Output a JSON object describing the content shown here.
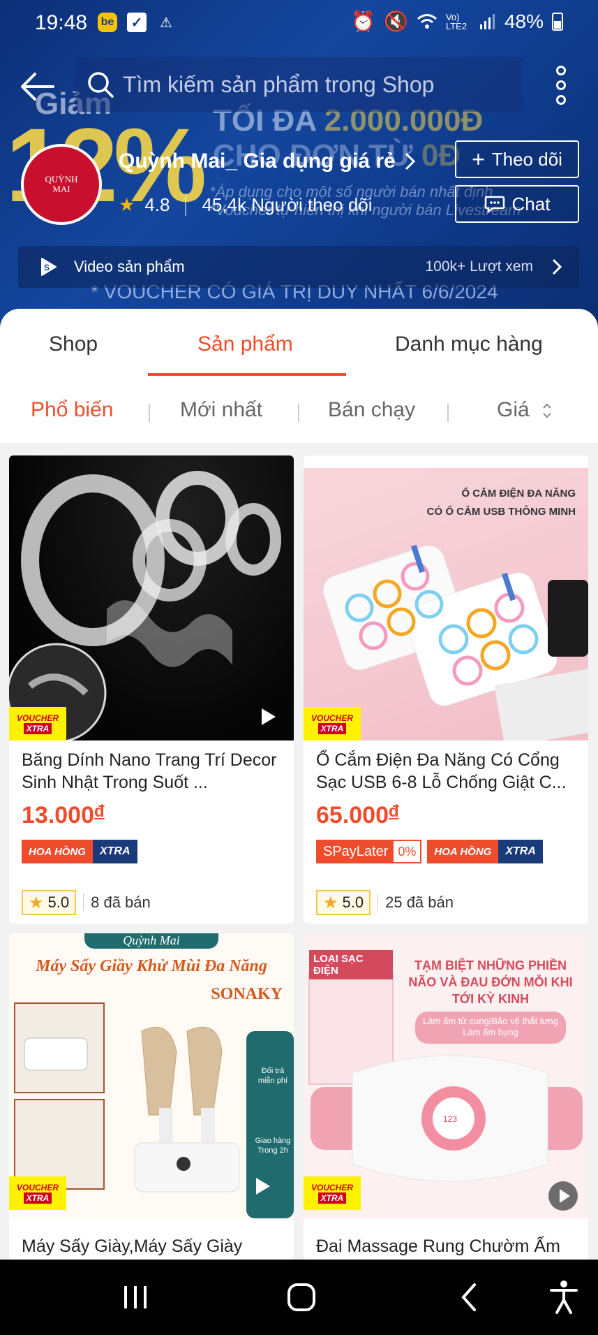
{
  "status_bar": {
    "time": "19:48",
    "battery": "48%",
    "network": "Vo) LTE2"
  },
  "search": {
    "placeholder": "Tìm kiếm sản phẩm trong Shop"
  },
  "banner": {
    "giam": "Giảm",
    "big_percent": "12%",
    "toi_da": "TỐI ĐA",
    "toi_da_amount": "2.000.000Đ",
    "cho_don": "CHO ĐƠN TỪ",
    "cho_don_amount": "0Đ",
    "note1": "*Áp dụng cho một số người bán nhất định",
    "note2": "*Voucher tự hiển thị khi người bán Livestream",
    "voucher_line": "* VOUCHER CÓ GIÁ TRỊ DUY NHẤT 6/6/2024"
  },
  "shop": {
    "avatar_line1": "QUỲNH",
    "avatar_line2": "MAI",
    "name": "Quỳnh Mai_ Gia dụng giá rẻ",
    "rating": "4.8",
    "followers": "45,4k Người theo dõi",
    "follow_label": "Theo dõi",
    "chat_label": "Chat"
  },
  "video_strip": {
    "label": "Video sản phẩm",
    "views": "100k+ Lượt xem"
  },
  "tabs": [
    {
      "label": "Shop"
    },
    {
      "label": "Sản phẩm"
    },
    {
      "label": "Danh mục hàng"
    }
  ],
  "sort": [
    {
      "label": "Phổ biến"
    },
    {
      "label": "Mới nhất"
    },
    {
      "label": "Bán chạy"
    },
    {
      "label": "Giá"
    }
  ],
  "voucher_tag": {
    "line1": "VOUCHER",
    "line2": "XTRA"
  },
  "hoa_hong": {
    "part1": "HOA HỒNG",
    "part2": "XTRA"
  },
  "spaylater": {
    "label": "SPayLater",
    "rate": "0%"
  },
  "products": [
    {
      "title": "Băng Dính Nano Trang Trí Decor Sinh Nhật Trong Suốt ...",
      "price": "13.000",
      "currency": "đ",
      "rating": "5.0",
      "sold": "8 đã bán"
    },
    {
      "title": "Ổ Cắm Điện Đa Năng Có Cổng Sạc USB 6-8 Lỗ  Chống Giật C...",
      "price": "65.000",
      "currency": "đ",
      "rating": "5.0",
      "sold": "25 đã bán",
      "image_text1": "Ổ CẮM ĐIỆN ĐA NĂNG",
      "image_text2": "CÓ Ổ CẮM USB THÔNG MINH"
    },
    {
      "title": "Máy Sấy Giày,Máy Sấy Giày",
      "image_brand": "Quỳnh Mai",
      "image_text1": "Máy Sấy Giầy Khử Mùi Đa Năng",
      "image_text2": "SONAKY",
      "image_badge1": "Đổi trả miễn phí",
      "image_badge2": "Giao hàng Trong 2h"
    },
    {
      "title": "Đai Massage Rung Chườm Ấm",
      "image_text1": "LOẠI SẠC ĐIỆN",
      "image_text2": "TẠM BIỆT NHỮNG PHIỀN NÃO VÀ ĐAU ĐỚN MỖI KHI TỚI KỲ KINH",
      "image_text3": "Làm ấm tử cung/Bảo vệ thắt lưng Làm ấm bụng"
    }
  ],
  "colors": {
    "accent": "#ee4d2d",
    "banner": "#14479e",
    "voucher_yellow": "#fff200"
  }
}
